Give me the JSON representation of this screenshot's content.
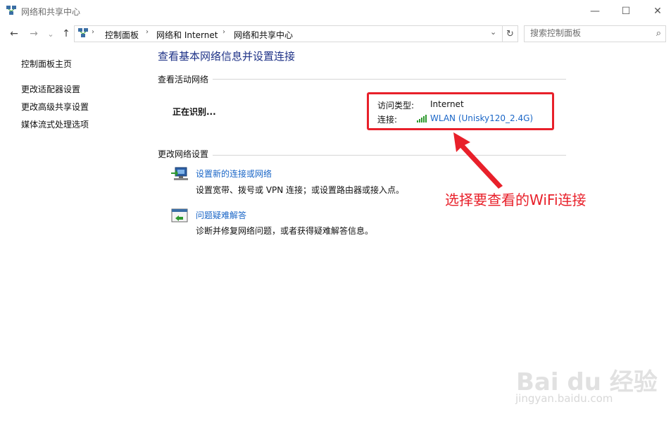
{
  "window": {
    "title": "网络和共享中心",
    "minimize_glyph": "—",
    "maximize_glyph": "☐",
    "close_glyph": "✕"
  },
  "nav": {
    "back_glyph": "←",
    "forward_glyph": "→",
    "dropdown_glyph": "⌄",
    "up_glyph": "↑"
  },
  "breadcrumb": {
    "items": [
      "控制面板",
      "网络和 Internet",
      "网络和共享中心"
    ],
    "separator": "›"
  },
  "address": {
    "dropdown_glyph": "⌄",
    "refresh_glyph": "↻"
  },
  "search": {
    "placeholder": "搜索控制面板",
    "icon_glyph": "⌕"
  },
  "sidebar": {
    "items": [
      {
        "label": "控制面板主页"
      },
      {
        "label": "更改适配器设置"
      },
      {
        "label": "更改高级共享设置"
      },
      {
        "label": "媒体流式处理选项"
      }
    ]
  },
  "main": {
    "title": "查看基本网络信息并设置连接",
    "active_networks": {
      "heading": "查看活动网络",
      "network_name": "正在识别...",
      "access_type_label": "访问类型:",
      "access_type_value": "Internet",
      "connection_label": "连接:",
      "connection_value": "WLAN (Unisky120_2.4G)"
    },
    "change_settings": {
      "heading": "更改网络设置",
      "items": [
        {
          "title": "设置新的连接或网络",
          "description": "设置宽带、拨号或 VPN 连接；或设置路由器或接入点。"
        },
        {
          "title": "问题疑难解答",
          "description": "诊断并修复网络问题，或者获得疑难解答信息。"
        }
      ]
    }
  },
  "annotation": {
    "text": "选择要查看的WiFi连接",
    "color": "#e8202a"
  },
  "watermark": {
    "logo": "Bai du 经验",
    "url": "jingyan.baidu.com"
  },
  "colors": {
    "link": "#1a66c7",
    "title": "#1e3287",
    "wifi_signal": "#2f9a2f"
  }
}
